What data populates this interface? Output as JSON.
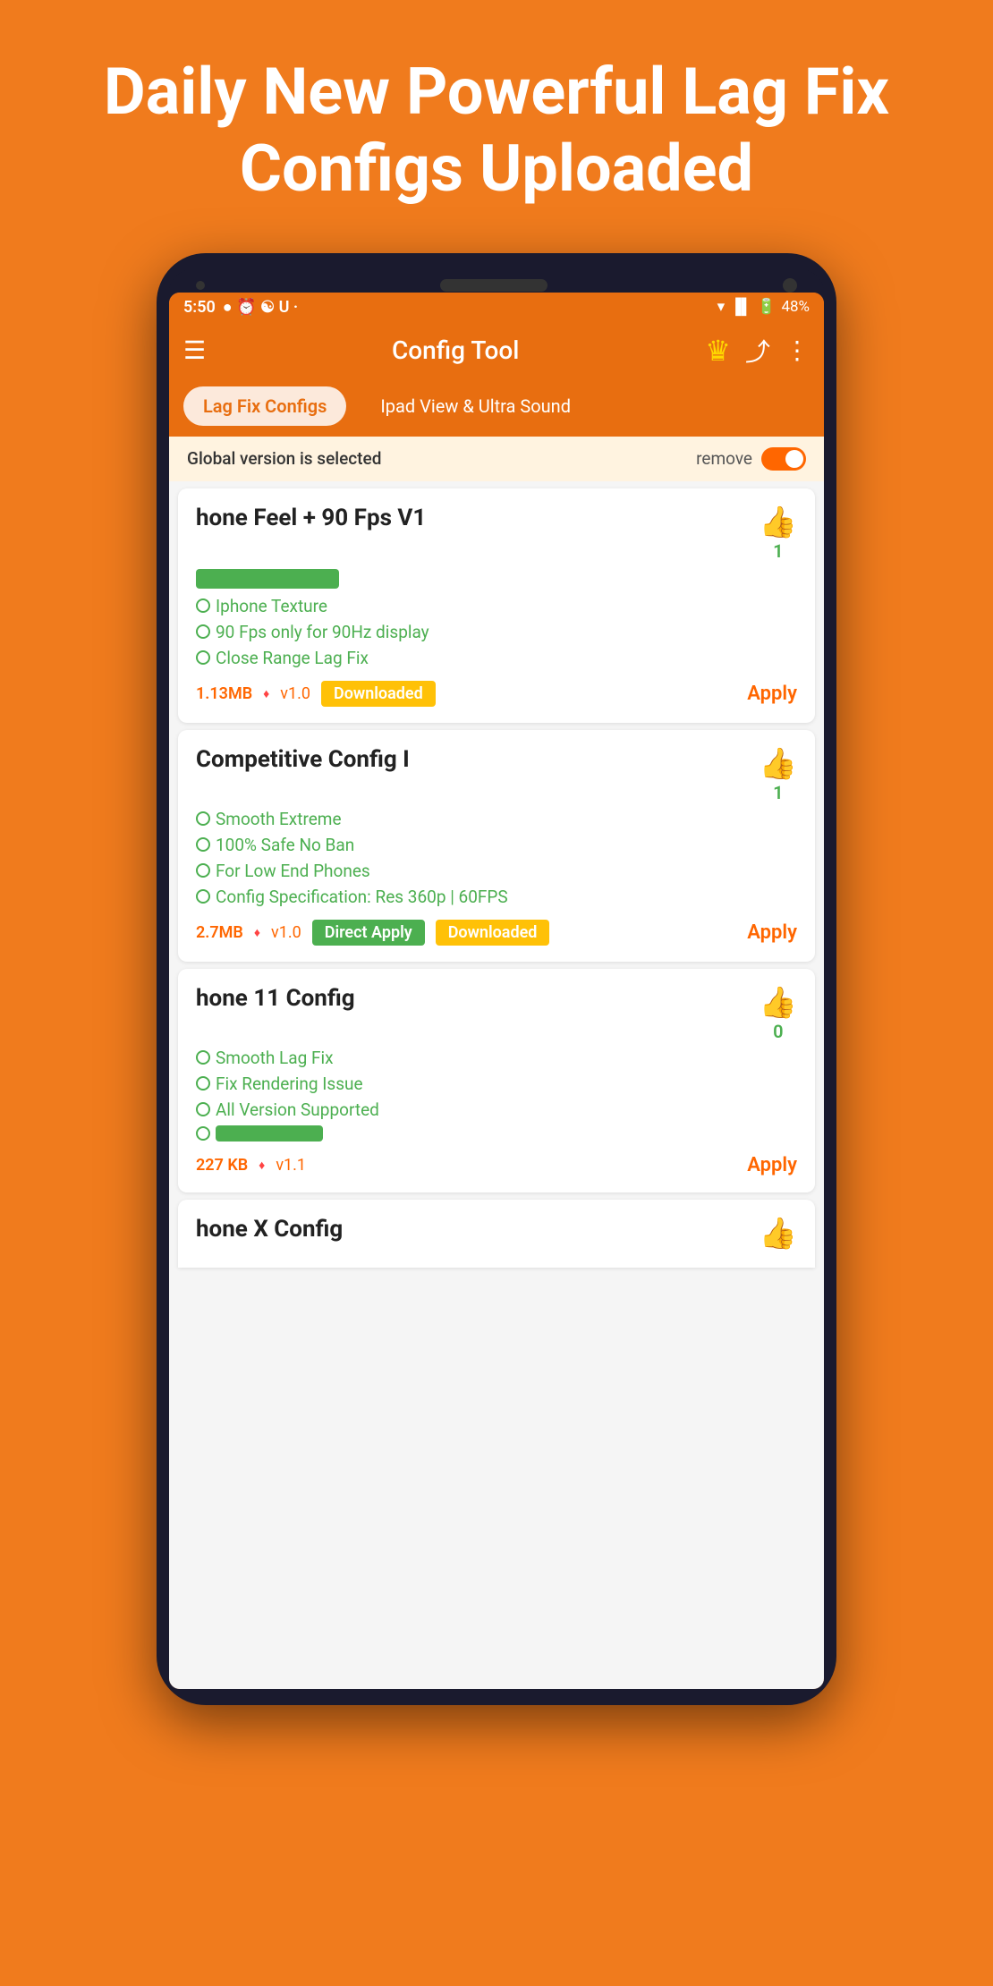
{
  "hero": {
    "title": "Daily New Powerful Lag Fix Configs Uploaded"
  },
  "statusBar": {
    "time": "5:50",
    "battery": "48%"
  },
  "toolbar": {
    "title": "Config Tool"
  },
  "tabs": {
    "active": "Lag Fix Configs",
    "inactive": "Ipad View & Ultra Sound"
  },
  "globalBanner": {
    "text": "Global version is selected",
    "removeLabel": "remove"
  },
  "cards": [
    {
      "title": "hone Feel + 90 Fps V1",
      "likes": "1",
      "features": [
        "Iphone Texture",
        "90 Fps only for 90Hz display",
        "Close Range Lag Fix"
      ],
      "hasBar": true,
      "fileSize": "1.13MB",
      "version": "v1.0",
      "badges": [
        "Downloaded"
      ],
      "applyLabel": "Apply"
    },
    {
      "title": "Competitive Config I",
      "likes": "1",
      "features": [
        "Smooth Extreme",
        "100% Safe No Ban",
        "For Low End Phones",
        "Config Specification: Res 360p | 60FPS"
      ],
      "hasBar": false,
      "fileSize": "2.7MB",
      "version": "v1.0",
      "badges": [
        "Direct Apply",
        "Downloaded"
      ],
      "applyLabel": "Apply"
    },
    {
      "title": "hone 11 Config",
      "likes": "0",
      "features": [
        "Smooth Lag Fix",
        "Fix Rendering Issue",
        "All Version Supported"
      ],
      "hasBar": true,
      "fileSize": "227 KB",
      "version": "v1.1",
      "badges": [],
      "applyLabel": "Apply"
    },
    {
      "title": "hone X Config",
      "likes": "",
      "features": [],
      "hasBar": false,
      "fileSize": "",
      "version": "",
      "badges": [],
      "applyLabel": ""
    }
  ]
}
